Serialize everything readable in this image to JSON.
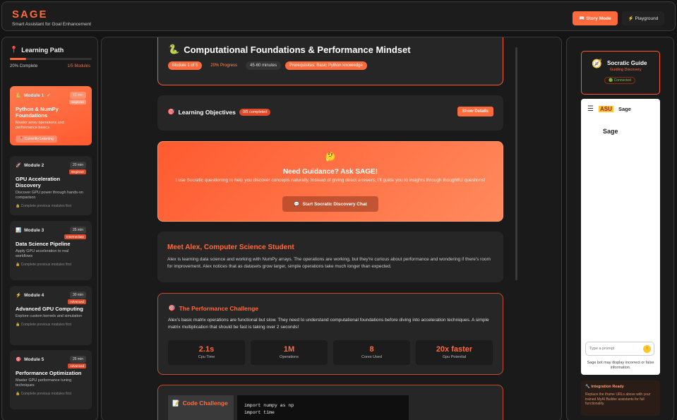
{
  "app": {
    "logo": "SAGE",
    "tagline": "Smart Assistant for Goal Enhancement",
    "modes": [
      "📖 Story Mode",
      "⚡ Playground"
    ]
  },
  "sidebar": {
    "title": "Learning Path",
    "title_icon": "📍",
    "progress_percent": 20,
    "progress_label": "20% Complete",
    "modules_count": "1/5 Modules",
    "modules": [
      {
        "label": "Module 1",
        "icon": "🐍",
        "check": "✓",
        "time": "15 min",
        "level": "Beginner",
        "name": "Python & NumPy Foundations",
        "desc": "Master array operations and performance basics",
        "status": "📍 Currently Learning"
      },
      {
        "label": "Module 2",
        "icon": "🚀",
        "check": "",
        "time": "20 min",
        "level": "Beginner",
        "name": "GPU Acceleration Discovery",
        "desc": "Discover GPU power through hands-on comparison",
        "status": "🔒 Complete previous modules first"
      },
      {
        "label": "Module 3",
        "icon": "📊",
        "check": "",
        "time": "25 min",
        "level": "Intermediate",
        "name": "Data Science Pipeline",
        "desc": "Apply GPU acceleration to real workflows",
        "status": "🔒 Complete previous modules first"
      },
      {
        "label": "Module 4",
        "icon": "⚡",
        "check": "",
        "time": "30 min",
        "level": "Advanced",
        "name": "Advanced GPU Computing",
        "desc": "Explore custom kernels and simulation",
        "status": "🔒 Complete previous modules first"
      },
      {
        "label": "Module 5",
        "icon": "🎯",
        "check": "",
        "time": "25 min",
        "level": "Advanced",
        "name": "Performance Optimization",
        "desc": "Master GPU performance tuning techniques",
        "status": "🔒 Complete previous modules first"
      }
    ]
  },
  "main": {
    "header": {
      "icon": "🐍",
      "title": "Computational Foundations & Performance Mindset",
      "tags": [
        "Module 1 of 5",
        "20% Progress",
        "45-60 minutes",
        "Prerequisites: Basic Python knowledge"
      ]
    },
    "objectives": {
      "icon": "🎯",
      "title": "Learning Objectives",
      "badge": "0/5 completed",
      "button": "Show Details"
    },
    "guidance": {
      "emoji": "🤔",
      "title": "Need Guidance? Ask SAGE!",
      "text": "I use Socratic questioning to help you discover concepts naturally. Instead of giving direct answers, I'll guide you to insights through thoughtful questions!",
      "button_icon": "💬",
      "button": "Start Socratic Discovery Chat"
    },
    "meet": {
      "title": "Meet Alex, Computer Science Student",
      "text": "Alex is learning data science and working with NumPy arrays. The operations are working, but they're curious about performance and wondering if there's room for improvement. Alex notices that as datasets grow larger, simple operations take much longer than expected."
    },
    "challenge": {
      "icon": "🎯",
      "title": "The Performance Challenge",
      "text": "Alex's basic matrix operations are functional but slow. They need to understand computational foundations before diving into acceleration techniques. A simple matrix multiplication that should be fast is taking over 2 seconds!",
      "stats": [
        {
          "value": "2.1s",
          "label": "Cpu Time"
        },
        {
          "value": "1M",
          "label": "Operations"
        },
        {
          "value": "8",
          "label": "Cores Used"
        },
        {
          "value": "20x faster",
          "label": "Gpu Potential"
        }
      ]
    },
    "code": {
      "icon": "📝",
      "label": "Code Challenge",
      "lines": [
        "import numpy as np",
        "import time"
      ]
    }
  },
  "right": {
    "guide": {
      "icon": "🧭",
      "title": "Socratic Guide",
      "subtitle": "Guiding Discovery",
      "status": "🟢 Connected"
    },
    "chat": {
      "menu_icon": "☰",
      "logo": "ASU",
      "name": "Sage",
      "heading": "Sage",
      "placeholder": "Type a prompt",
      "send_icon": "↑",
      "disclaimer": "Sage bot may display incorrect or false information."
    },
    "integration": {
      "title": "🔧 Integration Ready",
      "text": "Replace the iframe URLs above with your trained MyAI Builder assistants for full functionality."
    }
  }
}
